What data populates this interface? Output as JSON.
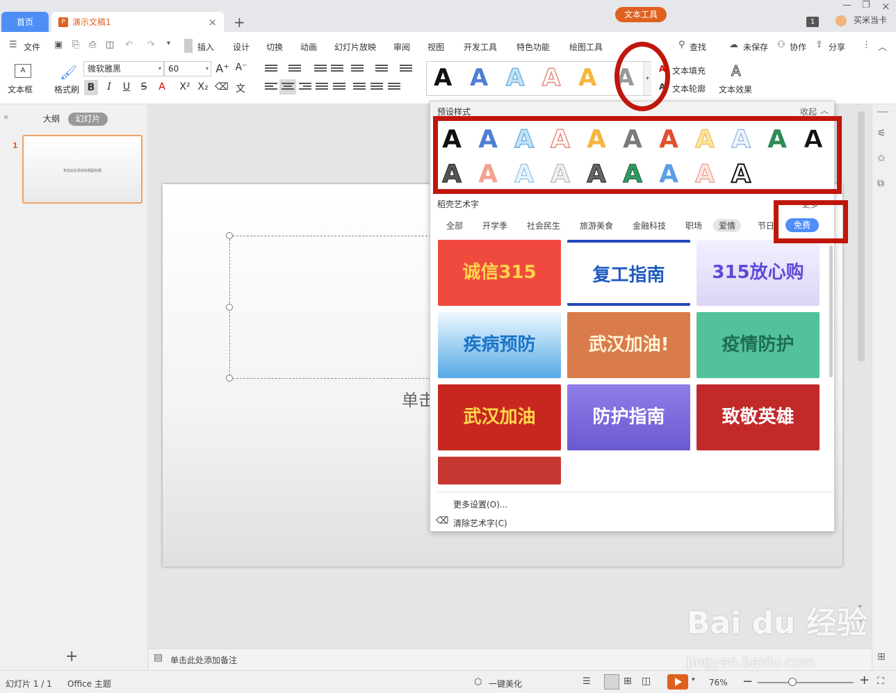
{
  "tabs": {
    "home": "首页",
    "doc": "演示文稿1",
    "close": "×",
    "new": "+"
  },
  "window": {
    "minimize": "—",
    "restore": "❐",
    "badge": "1",
    "user": "买米当卡"
  },
  "menu": {
    "file": "文件",
    "items": [
      "插入",
      "设计",
      "切换",
      "动画",
      "幻灯片放映",
      "审阅",
      "视图",
      "开发工具",
      "特色功能",
      "绘图工具"
    ],
    "active": "文本工具",
    "search": "查找",
    "unsaved": "未保存",
    "collab": "协作",
    "share": "分享"
  },
  "ribbon": {
    "textbox": "文本框",
    "format_brush": "格式刷",
    "font": "微软雅黑",
    "size": "60",
    "text_fill": "文本填充",
    "text_outline": "文本轮廓",
    "text_effect": "文本效果",
    "gallery_letter": "A"
  },
  "sidebar": {
    "outline": "大纲",
    "slides": "幻灯片",
    "slide_no": "1",
    "thumb_text": "单击此处添加标题副标题",
    "add": "+"
  },
  "slide": {
    "subtitle": "单击"
  },
  "notes": {
    "placeholder": "单击此处添加备注"
  },
  "status": {
    "slide": "幻灯片 1 / 1",
    "theme": "Office 主题",
    "beautify": "一键美化",
    "zoom": "76%"
  },
  "dropdown": {
    "preset_title": "预设样式",
    "collapse": "收起",
    "wordart_title": "稻壳艺术字",
    "more": "更多",
    "categories": [
      "全部",
      "开学季",
      "社会民生",
      "旅游美食",
      "金融科技",
      "职场",
      "爱情",
      "节日"
    ],
    "free": "免费",
    "cards": [
      "诚信315",
      "复工指南",
      "315放心购",
      "疾病预防",
      "武汉加油!",
      "疫情防护",
      "武汉加油",
      "防护指南",
      "致敬英雄"
    ],
    "more_settings": "更多设置(O)...",
    "clear": "清除艺术字(C)"
  },
  "watermark": {
    "brand": "Bai du 经验",
    "url": "jingyan.baidu.com"
  }
}
